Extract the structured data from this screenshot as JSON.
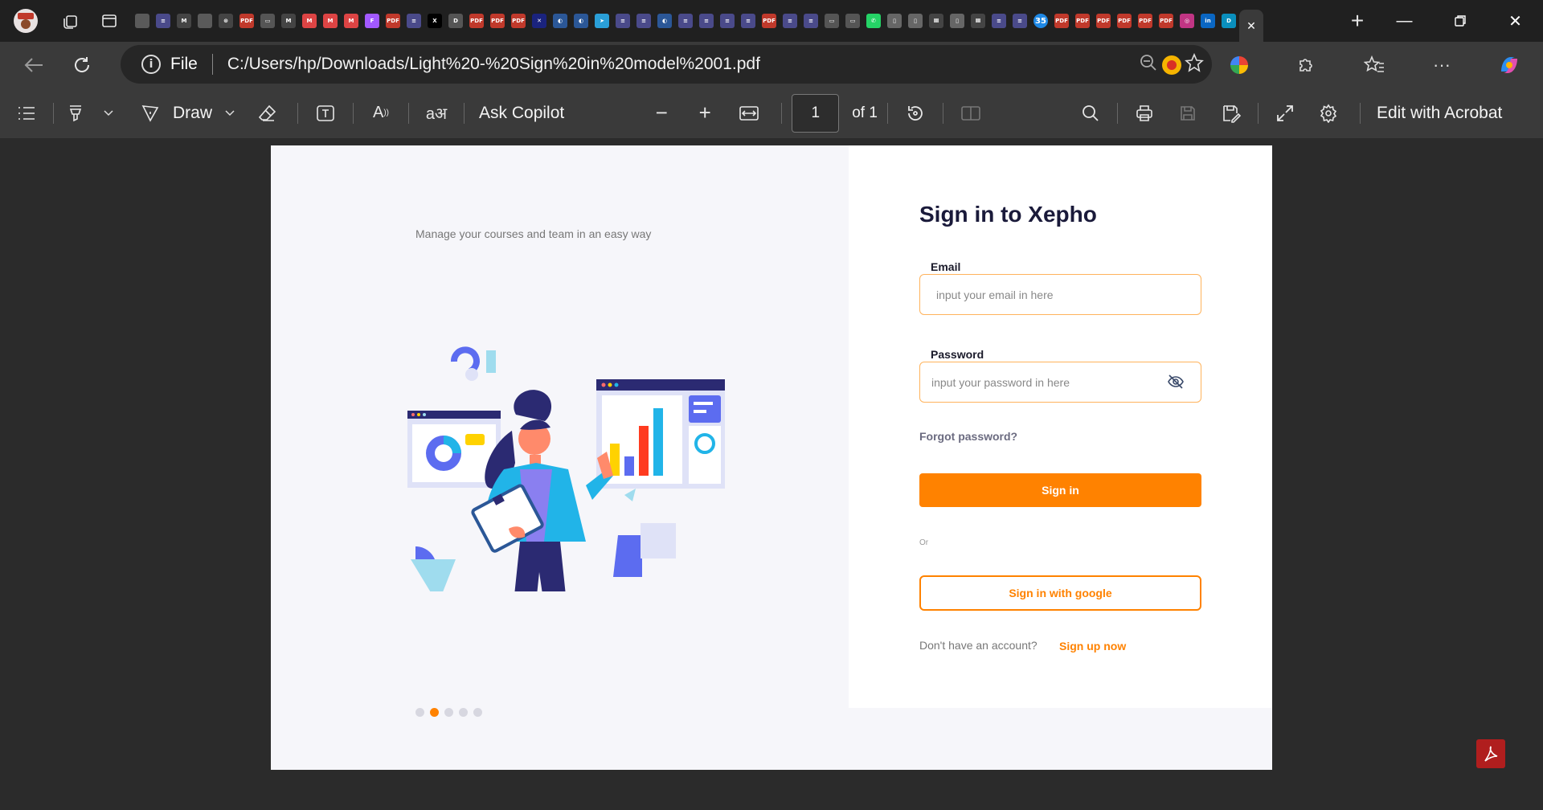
{
  "browser": {
    "tab_count_badge": "35",
    "favicons": [
      {
        "name": "pdf-favicon",
        "color": "#5a5a5a",
        "text": ""
      },
      {
        "name": "list-favicon",
        "color": "#4a4a8a",
        "text": "≡"
      },
      {
        "name": "gmail-favicon",
        "color": "#444",
        "text": "M"
      },
      {
        "name": "pdf-favicon",
        "color": "#5a5a5a",
        "text": ""
      },
      {
        "name": "chatgpt-favicon",
        "color": "#444",
        "text": "⊛"
      },
      {
        "name": "pdf-favicon",
        "color": "#c0392b",
        "text": "PDF"
      },
      {
        "name": "doc-favicon",
        "color": "#555",
        "text": "▭"
      },
      {
        "name": "gmail-favicon",
        "color": "#444",
        "text": "M"
      },
      {
        "name": "gmail-favicon",
        "color": "#d44",
        "text": "M"
      },
      {
        "name": "gmail-favicon",
        "color": "#d44",
        "text": "M"
      },
      {
        "name": "gmail-favicon",
        "color": "#d44",
        "text": "M"
      },
      {
        "name": "figma-favicon",
        "color": "#a259ff",
        "text": "F"
      },
      {
        "name": "pdf-favicon",
        "color": "#c0392b",
        "text": "PDF"
      },
      {
        "name": "list-favicon",
        "color": "#4a4a8a",
        "text": "≡"
      },
      {
        "name": "x-favicon",
        "color": "#000",
        "text": "X"
      },
      {
        "name": "list-favicon",
        "color": "#555",
        "text": "D"
      },
      {
        "name": "pdf-favicon",
        "color": "#c0392b",
        "text": "PDF"
      },
      {
        "name": "pdf-favicon",
        "color": "#c0392b",
        "text": "PDF"
      },
      {
        "name": "pdf-favicon",
        "color": "#c0392b",
        "text": "PDF"
      },
      {
        "name": "uk-favicon",
        "color": "#1a237e",
        "text": "✕"
      },
      {
        "name": "globe-favicon",
        "color": "#2b5797",
        "text": "◐"
      },
      {
        "name": "globe-favicon",
        "color": "#2b5797",
        "text": "◐"
      },
      {
        "name": "telegram-favicon",
        "color": "#2a9fd8",
        "text": "➤"
      },
      {
        "name": "list-favicon",
        "color": "#4a4a8a",
        "text": "≡"
      },
      {
        "name": "list-favicon",
        "color": "#4a4a8a",
        "text": "≡"
      },
      {
        "name": "globe-favicon",
        "color": "#2b5797",
        "text": "◐"
      },
      {
        "name": "list-favicon",
        "color": "#4a4a8a",
        "text": "≡"
      },
      {
        "name": "list-favicon",
        "color": "#4a4a8a",
        "text": "≡"
      },
      {
        "name": "list-favicon",
        "color": "#4a4a8a",
        "text": "≡"
      },
      {
        "name": "list-favicon",
        "color": "#4a4a8a",
        "text": "≡"
      },
      {
        "name": "pdf-favicon",
        "color": "#c0392b",
        "text": "PDF"
      },
      {
        "name": "list-favicon",
        "color": "#4a4a8a",
        "text": "≡"
      },
      {
        "name": "list-favicon",
        "color": "#4a4a8a",
        "text": "≡"
      },
      {
        "name": "doc-favicon",
        "color": "#555",
        "text": "▭"
      },
      {
        "name": "doc-favicon",
        "color": "#555",
        "text": "▭"
      },
      {
        "name": "whatsapp-favicon",
        "color": "#25d366",
        "text": "✆"
      },
      {
        "name": "page-favicon",
        "color": "#666",
        "text": "▯"
      },
      {
        "name": "page-favicon",
        "color": "#666",
        "text": "▯"
      },
      {
        "name": "table-favicon",
        "color": "#444",
        "text": "Ⅲ"
      },
      {
        "name": "page-favicon",
        "color": "#666",
        "text": "▯"
      },
      {
        "name": "table-favicon",
        "color": "#444",
        "text": "Ⅲ"
      },
      {
        "name": "list-favicon",
        "color": "#4a4a8a",
        "text": "≡"
      },
      {
        "name": "list-favicon",
        "color": "#4a4a8a",
        "text": "≡"
      },
      {
        "name": "badge-favicon",
        "color": "#1e88e5",
        "text": "35"
      },
      {
        "name": "pdf-favicon",
        "color": "#c0392b",
        "text": "PDF"
      },
      {
        "name": "pdf-favicon",
        "color": "#c0392b",
        "text": "PDF"
      },
      {
        "name": "pdf-favicon",
        "color": "#c0392b",
        "text": "PDF"
      },
      {
        "name": "pdf-favicon",
        "color": "#c0392b",
        "text": "PDF"
      },
      {
        "name": "pdf-favicon",
        "color": "#c0392b",
        "text": "PDF"
      },
      {
        "name": "pdf-favicon",
        "color": "#c0392b",
        "text": "PDF"
      },
      {
        "name": "instagram-favicon",
        "color": "#c13584",
        "text": "◎"
      },
      {
        "name": "linkedin-favicon",
        "color": "#0a66c2",
        "text": "in"
      },
      {
        "name": "dribbble-favicon",
        "color": "#0a8fbd",
        "text": "D"
      }
    ]
  },
  "address": {
    "file_label": "File",
    "url": "C:/Users/hp/Downloads/Light%20-%20Sign%20in%20model%2001.pdf"
  },
  "pdf_toolbar": {
    "draw_label": "Draw",
    "ask_copilot_label": "Ask Copilot",
    "page_current": "1",
    "page_total_label": "of 1",
    "edit_acrobat_label": "Edit with Acrobat"
  },
  "page": {
    "tagline": "Manage your courses and team in an easy way",
    "carousel_dots": 5,
    "carousel_active_index": 1,
    "title": "Sign in to Xepho",
    "email_label": "Email",
    "email_placeholder": "input your email in here",
    "password_label": "Password",
    "password_placeholder": "input your password in here",
    "forgot_label": "Forgot password?",
    "signin_label": "Sign in",
    "or_label": "Or",
    "google_label": "Sign in with google",
    "no_account_label": "Don't have an account?",
    "signup_label": "Sign up now"
  },
  "colors": {
    "accent": "#ff8200",
    "heading": "#1a1a3a",
    "illustration_purple": "#2b2a72",
    "illustration_blue": "#21b4e8"
  }
}
